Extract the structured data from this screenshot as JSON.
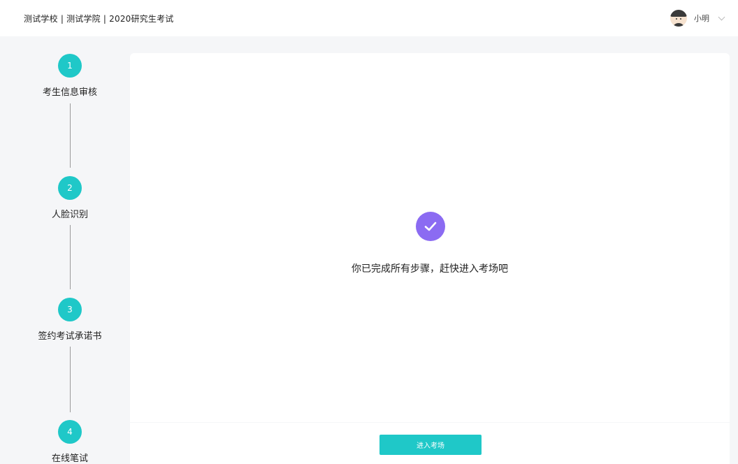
{
  "header": {
    "breadcrumb": "测试学校 | 测试学院 | 2020研究生考试",
    "user": {
      "name": "小明"
    }
  },
  "steps": [
    {
      "number": "1",
      "label": "考生信息审核"
    },
    {
      "number": "2",
      "label": "人脸识别"
    },
    {
      "number": "3",
      "label": "签约考试承诺书"
    },
    {
      "number": "4",
      "label": "在线笔试"
    }
  ],
  "main": {
    "message": "你已完成所有步骤，赶快进入考场吧",
    "enter_button": "进入考场"
  },
  "colors": {
    "accent": "#1fc8c8",
    "success": "#8b6bf2",
    "background": "#f5f6f8"
  }
}
